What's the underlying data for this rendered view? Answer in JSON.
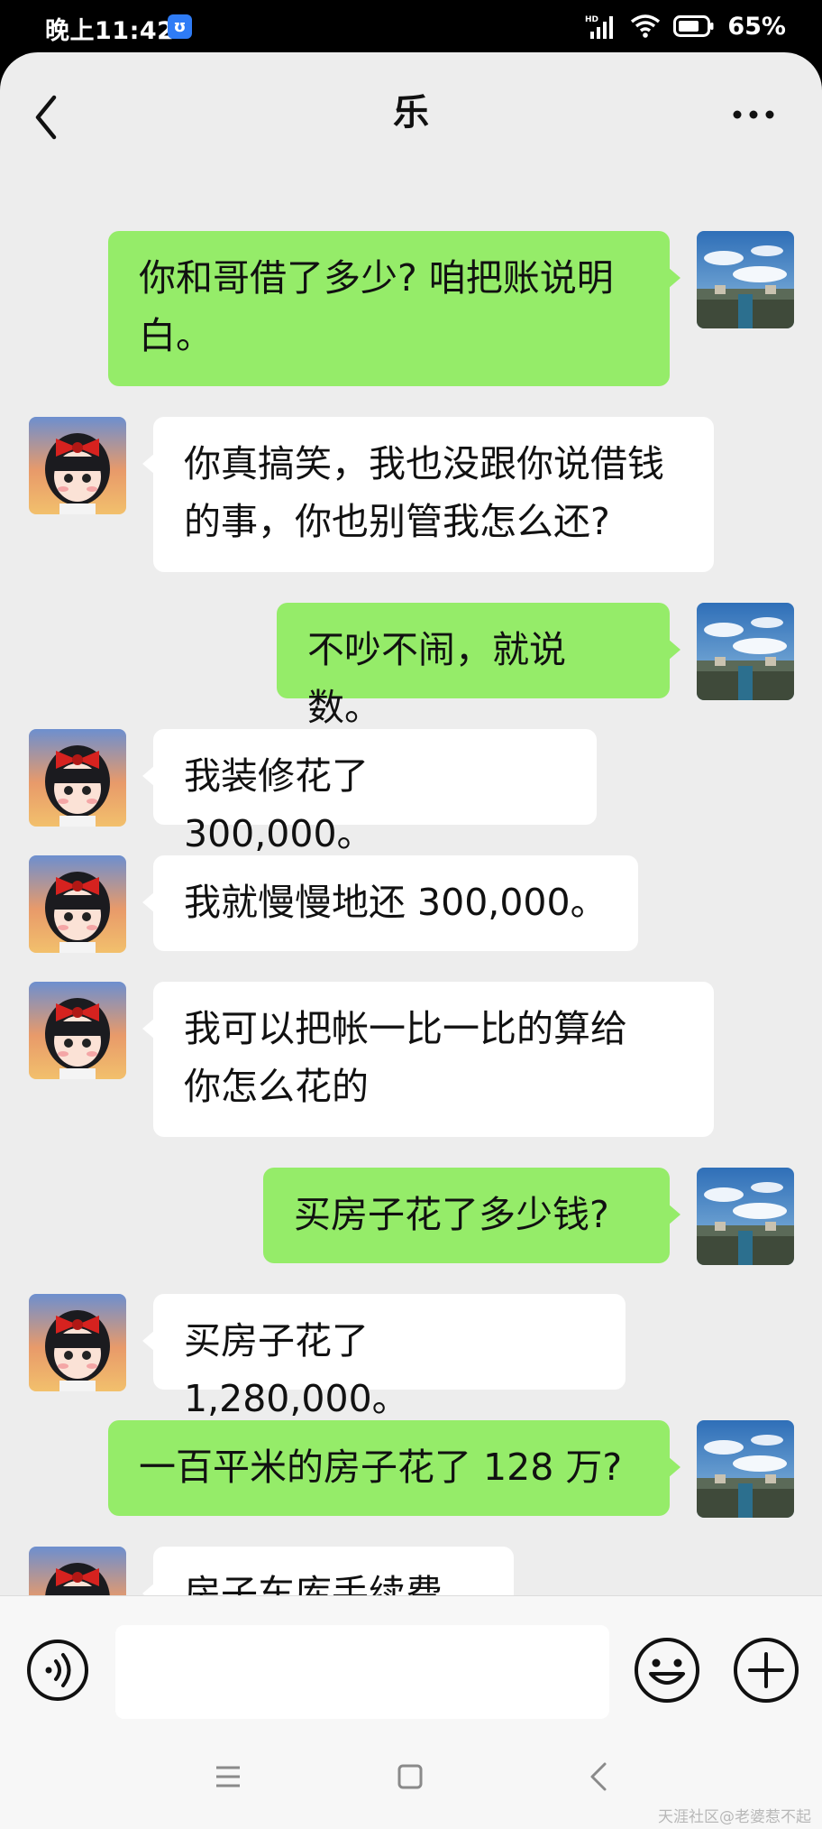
{
  "status": {
    "time": "晚上11:42",
    "app_badge": "ʊ",
    "network": "HD",
    "battery": "65%"
  },
  "chat": {
    "title": "乐"
  },
  "messages": [
    {
      "side": "right",
      "text": "你和哥借了多少? 咱把账说明\n白。"
    },
    {
      "side": "left",
      "text": "你真搞笑，我也没跟你说借钱\n的事，你也别管我怎么还?"
    },
    {
      "side": "right",
      "text": "不吵不闹，就说数。"
    },
    {
      "side": "left",
      "text": "我装修花了 300,000。"
    },
    {
      "side": "left",
      "text": "我就慢慢地还 300,000。"
    },
    {
      "side": "left",
      "text": "我可以把帐一比一比的算给\n你怎么花的"
    },
    {
      "side": "right",
      "text": "买房子花了多少钱?"
    },
    {
      "side": "left",
      "text": "买房子花了 1,280,000。"
    },
    {
      "side": "right",
      "text": "一百平米的房子花了 128 万?"
    },
    {
      "side": "left",
      "text": "房子车库手续费。"
    }
  ],
  "icons": {
    "back": "chevron-left-icon",
    "more": "more-dots-icon",
    "voice": "voice-icon",
    "emoji": "smile-icon",
    "plus": "plus-icon",
    "menu": "menu-icon",
    "home": "home-icon",
    "nav_back": "nav-back-icon"
  },
  "watermark": "天涯社区@老婆惹不起",
  "colors": {
    "sent_bubble": "#95ec69",
    "received_bubble": "#ffffff",
    "chat_bg": "#ededed"
  }
}
